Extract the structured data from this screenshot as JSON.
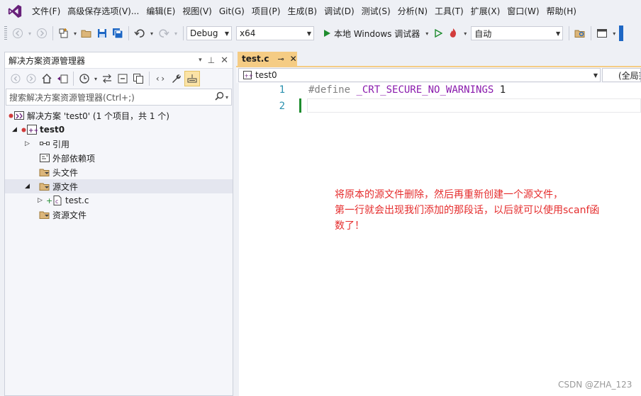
{
  "menu": [
    "文件(F)",
    "高级保存选项(V)...",
    "编辑(E)",
    "视图(V)",
    "Git(G)",
    "项目(P)",
    "生成(B)",
    "调试(D)",
    "测试(S)",
    "分析(N)",
    "工具(T)",
    "扩展(X)",
    "窗口(W)",
    "帮助(H)"
  ],
  "toolbar": {
    "config": "Debug",
    "platform": "x64",
    "run_label": "本地 Windows 调试器",
    "auto": "自动"
  },
  "solution_explorer": {
    "title": "解决方案资源管理器",
    "search_placeholder": "搜索解决方案资源管理器(Ctrl+;)",
    "tree": {
      "solution": "解决方案 'test0' (1 个项目，共 1 个)",
      "project": "test0",
      "references": "引用",
      "external_deps": "外部依赖项",
      "header_files": "头文件",
      "source_files": "源文件",
      "test_c": "test.c",
      "resource_files": "资源文件"
    }
  },
  "editor": {
    "tab": "test.c",
    "tab_pin": "⊸",
    "nav_left": "test0",
    "nav_right": "(全局范围)",
    "lines": [
      {
        "num": "1",
        "directive": "#define",
        "macro": "_CRT_SECURE_NO_WARNINGS",
        "value": "1"
      },
      {
        "num": "2"
      }
    ]
  },
  "annotation": [
    "将原本的源文件删除，然后再重新创建一个源文件，",
    "第一行就会出现我们添加的那段话，以后就可以使用scanf函",
    "数了！"
  ],
  "watermark": "CSDN @ZHA_123",
  "colors": {
    "accent": "#f5cc84",
    "vs_purple": "#68217a",
    "annotation": "#e52d2d",
    "run_green": "#1e8c2e"
  }
}
